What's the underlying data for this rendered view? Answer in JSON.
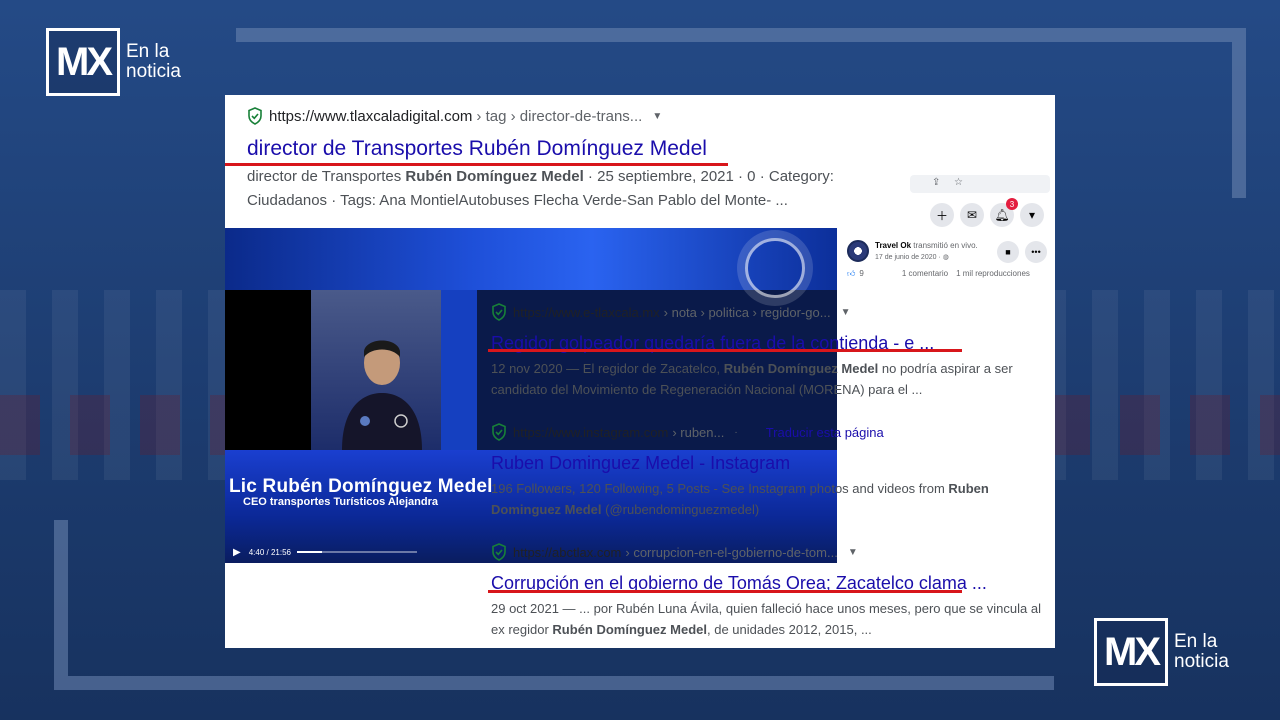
{
  "brand": {
    "mx": "MX",
    "line1": "En la",
    "line2": "noticia"
  },
  "results": [
    {
      "domain": "https://www.tlaxcaladigital.com",
      "path": "› tag › director-de-trans...",
      "title": "director de Transportes Rubén Domínguez Medel",
      "snippet_html": "director de Transportes <b>Rubén Domínguez Medel</b> · 25 septiembre, 2021 · 0 · Category: Ciudadanos · Tags: Ana MontielAutobuses Flecha Verde-San Pablo del Monte- ..."
    },
    {
      "domain": "https://www.e-tlaxcala.mx",
      "path": "› nota › politica › regidor-go...",
      "title": "Regidor golpeador quedaría fuera de la contienda - e ...",
      "snippet_html": "12 nov 2020 — El regidor de Zacatelco, <b>Rubén Domínguez Medel</b> no podría aspirar a ser candidato del Movimiento de Regeneración Nacional (MORENA) para el ..."
    },
    {
      "domain": "https://www.instagram.com",
      "path": "› ruben...",
      "translate": "Traducir esta página",
      "title": "Ruben Dominguez Medel - Instagram",
      "snippet_html": "196 Followers, 120 Following, 5 Posts - See Instagram photos and videos from <b>Ruben Dominguez Medel</b> (@rubendominguezmedel)"
    },
    {
      "domain": "https://abctlax.com",
      "path": "› corrupcion-en-el-gobierno-de-tom...",
      "title": "Corrupción en el gobierno de Tomás Orea; Zacatelco clama ...",
      "snippet_html": "29 oct 2021 — ... por Rubén Luna Ávila, quien falleció hace unos meses, pero que se vincula al ex regidor <b>Rubén Domínguez Medel</b>, de unidades 2012, 2015, ..."
    }
  ],
  "video": {
    "name": "Lic Rubén Domínguez Medel",
    "role": "CEO transportes Turísticos Alejandra",
    "time": "4:40 / 21:56",
    "progress": 0.21
  },
  "facebook": {
    "page_name": "Travel Ok",
    "action": "transmitió en vivo.",
    "date": "17 de junio de 2020 · ",
    "likes": "9",
    "comments": "1 comentario",
    "views": "1 mil reproducciones",
    "notif_count": "3"
  }
}
